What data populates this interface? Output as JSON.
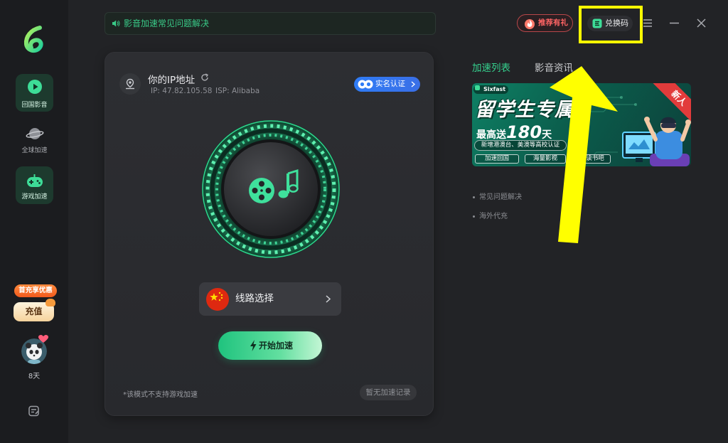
{
  "app": {
    "logo_icon": "app-logo-icon"
  },
  "sidebar": {
    "items": [
      {
        "label": "回国影音",
        "icon": "video-play-icon",
        "highlighted": true
      },
      {
        "label": "全球加速",
        "icon": "planet-icon",
        "highlighted": false
      },
      {
        "label": "游戏加速",
        "icon": "gamepad-icon",
        "highlighted": true
      }
    ],
    "promo_badge": "首充享优惠",
    "recharge_label": "充值",
    "user": {
      "avatar_icon": "avatar",
      "days_left": "8天"
    },
    "feedback_icon": "feedback-icon"
  },
  "topbar": {
    "notice": {
      "icon": "speaker-icon",
      "text": "影音加速常见问题解决"
    },
    "referral": {
      "icon": "fire-icon",
      "label": "推荐有礼"
    },
    "redeem": {
      "icon": "coupon-icon",
      "label": "兑换码"
    },
    "window_controls": [
      "menu-icon",
      "minimize-icon",
      "close-icon"
    ]
  },
  "ip_card": {
    "title": "你的IP地址",
    "refresh_icon": "refresh-icon",
    "ip_text": "IP: 47.82.105.58",
    "isp_text": "ISP: Alibaba",
    "verify_label": "实名认证",
    "main_icon": "film-music-icon",
    "route_flag": "china-flag-icon",
    "route_label": "线路选择",
    "start_label": "开始加速",
    "mode_note": "*该模式不支持游戏加速",
    "history_label": "暂无加速记录"
  },
  "right_panel": {
    "tabs": [
      {
        "label": "加速列表",
        "active": true
      },
      {
        "label": "影音资讯",
        "active": false
      }
    ],
    "banner": {
      "brand": "Sixfast",
      "headline": "留学生专属",
      "offer_prefix": "最高送",
      "offer_number": "180",
      "offer_unit": "天",
      "subline": "新增港澳台、美澳等高校认证",
      "features": [
        "加速回国",
        "海量影视",
        "读书吧"
      ],
      "ribbon": "新人"
    },
    "links": [
      "常见问题解决",
      "海外代充"
    ]
  },
  "annotation": {
    "color": "#ffff00"
  },
  "colors": {
    "accent": "#35d08e",
    "sidebar_bg": "#1b1c1f",
    "main_bg": "#222326",
    "card_bg": "#2b2c30",
    "verify_blue": "#2f7cf6",
    "referral_red": "#ff6464",
    "promo_orange": "#f4641f"
  }
}
